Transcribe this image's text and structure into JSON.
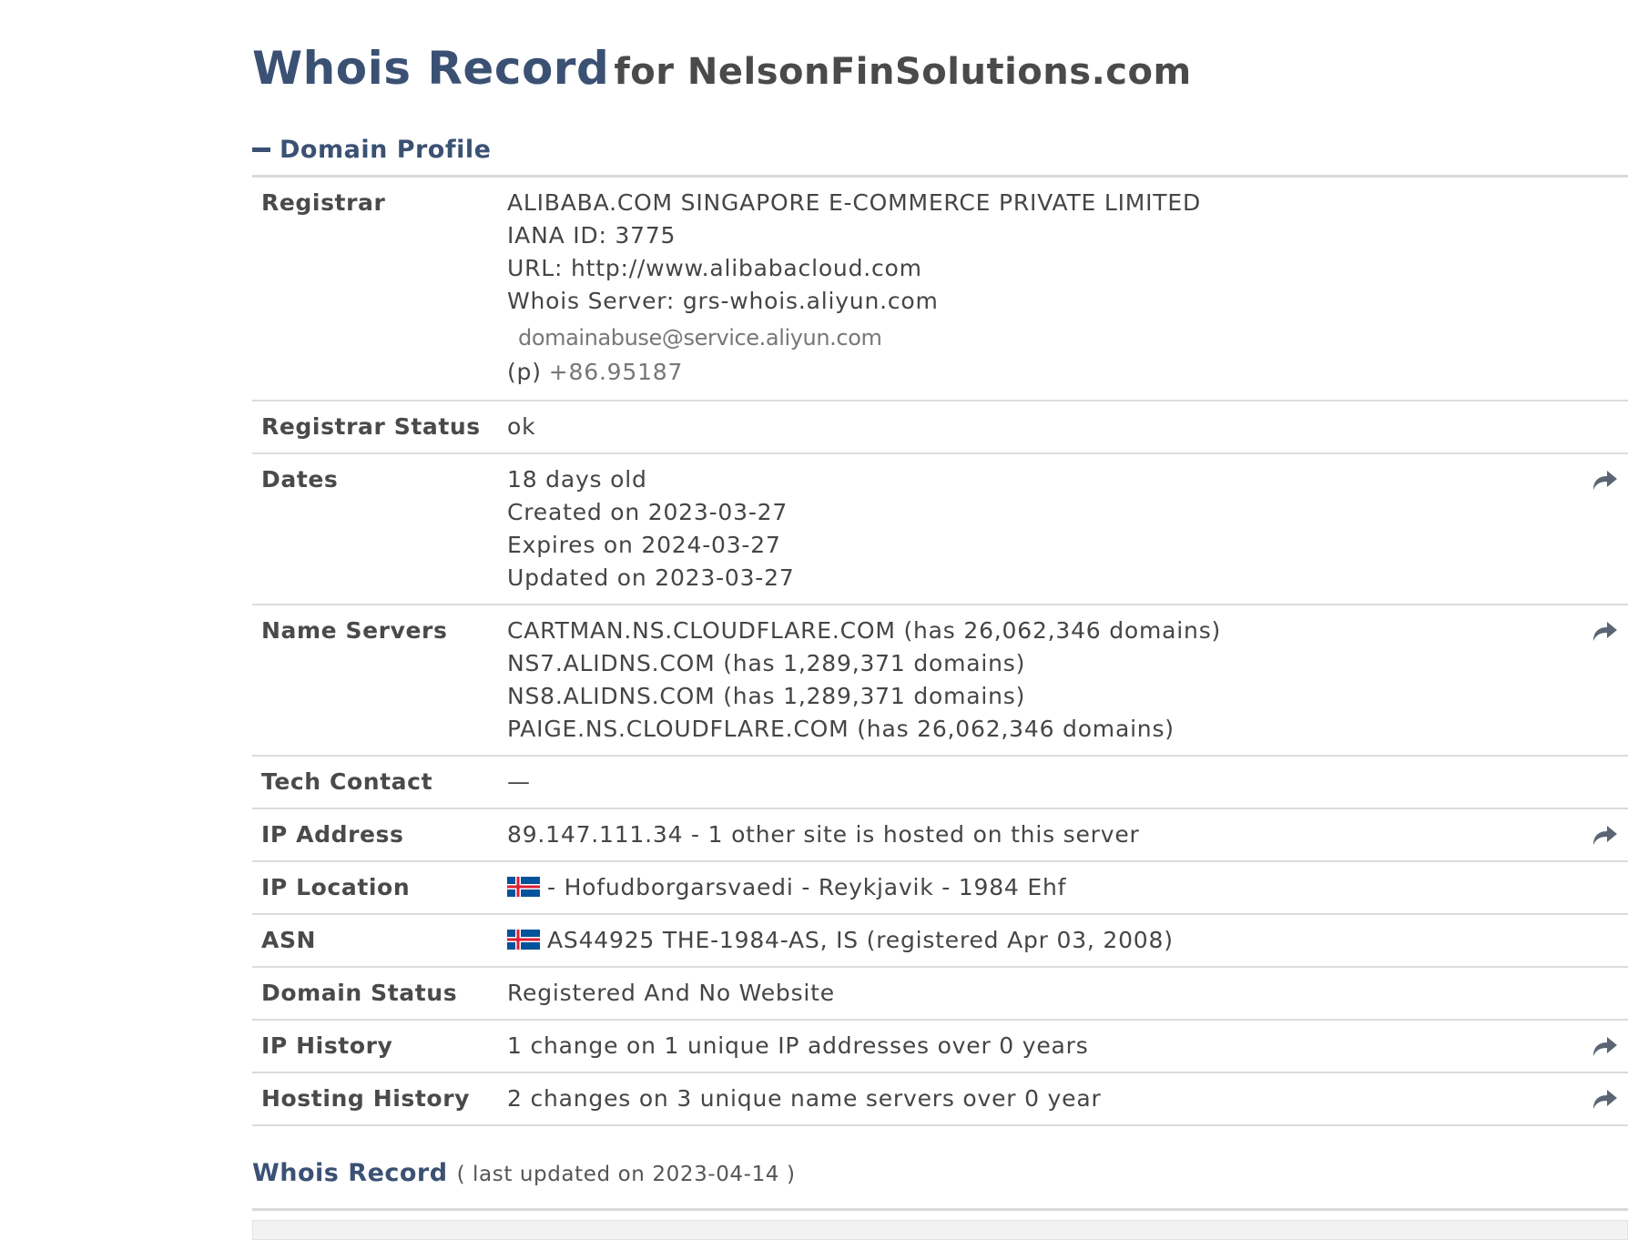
{
  "header": {
    "title": "Whois Record",
    "subtitle": "for NelsonFinSolutions.com"
  },
  "domain_profile": {
    "section_label": "Domain Profile",
    "registrar": {
      "label": "Registrar",
      "name": "ALIBABA.COM SINGAPORE E-COMMERCE PRIVATE LIMITED",
      "iana": "IANA ID: 3775",
      "url": "URL: http://www.alibabacloud.com",
      "whois_server": "Whois Server: grs-whois.aliyun.com",
      "email": "domainabuse@service.aliyun.com",
      "phone_prefix": "(p)",
      "phone": "+86.95187"
    },
    "registrar_status": {
      "label": "Registrar Status",
      "value": "ok"
    },
    "dates": {
      "label": "Dates",
      "age": "18 days old",
      "created": "Created on 2023-03-27",
      "expires": "Expires on 2024-03-27",
      "updated": "Updated on 2023-03-27"
    },
    "name_servers": {
      "label": "Name Servers",
      "items": [
        "CARTMAN.NS.CLOUDFLARE.COM (has 26,062,346 domains)",
        "NS7.ALIDNS.COM (has 1,289,371 domains)",
        "NS8.ALIDNS.COM (has 1,289,371 domains)",
        "PAIGE.NS.CLOUDFLARE.COM (has 26,062,346 domains)"
      ]
    },
    "tech_contact": {
      "label": "Tech Contact",
      "value": "—"
    },
    "ip_address": {
      "label": "IP Address",
      "value": "89.147.111.34 - 1 other site is hosted on this server"
    },
    "ip_location": {
      "label": "IP Location",
      "value": "- Hofudborgarsvaedi - Reykjavik - 1984 Ehf",
      "flag": "iceland-flag"
    },
    "asn": {
      "label": "ASN",
      "value": "AS44925 THE-1984-AS, IS (registered Apr 03, 2008)",
      "flag": "iceland-flag"
    },
    "domain_status": {
      "label": "Domain Status",
      "value": "Registered And No Website"
    },
    "ip_history": {
      "label": "IP History",
      "value": "1 change on 1 unique IP addresses over 0 years"
    },
    "hosting_history": {
      "label": "Hosting History",
      "value": "2 changes on 3 unique name servers over 0 year"
    }
  },
  "footer": {
    "title": "Whois Record",
    "note": "( last updated on 2023-04-14 )"
  },
  "colors": {
    "heading_blue": "#3b5174",
    "text": "#454545",
    "divider": "#dcdcdc",
    "flag_blue": "#02529c",
    "flag_red": "#dc1e35"
  }
}
